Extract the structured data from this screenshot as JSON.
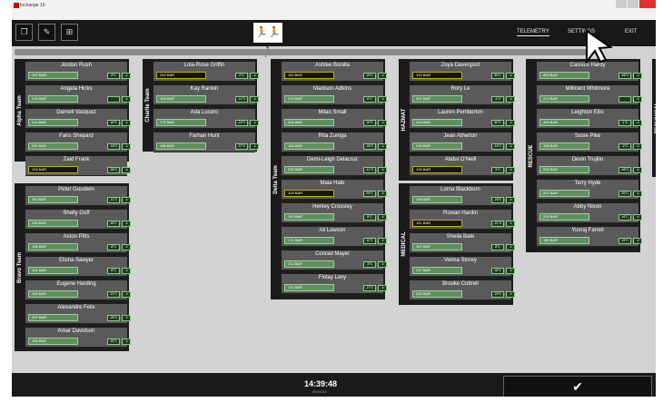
{
  "app": {
    "title": "Inchange 10"
  },
  "toolbar": [
    {
      "icon": "window-icon",
      "glyph": "❐"
    },
    {
      "icon": "edit-icon",
      "glyph": "✎"
    },
    {
      "icon": "grid-icon",
      "glyph": "⊞"
    }
  ],
  "logo": {
    "icon": "running-people-icon",
    "glyph": "🏃🏃🏃"
  },
  "nav": {
    "telemetry": "TELEMETRY",
    "settings": "SETTINGS",
    "exit": "EXIT"
  },
  "teams": [
    {
      "name": "Alpha Team",
      "members": [
        {
          "name": "Jordon Rush",
          "pressure": "197 BAR",
          "temp": "3°C",
          "alert": false
        },
        {
          "name": "Angela Hicks",
          "pressure": "216 BAR",
          "temp": "",
          "alert": false
        },
        {
          "name": "Darnell Vasquez",
          "pressure": "210 BAR",
          "temp": "15°C",
          "alert": false
        },
        {
          "name": "Faris Shepard",
          "pressure": "200 BAR",
          "temp": "-18°C",
          "alert": false
        },
        {
          "name": "Zaid Frank",
          "pressure": "133 BAR",
          "temp": "-38°C",
          "alert": true
        }
      ]
    },
    {
      "name": "Bravo Team",
      "members": [
        {
          "name": "Peter Goodwin",
          "pressure": "262 BAR",
          "temp": "-11°C",
          "alert": false
        },
        {
          "name": "Shelly Goff",
          "pressure": "246 BAR",
          "temp": "18°C",
          "alert": false
        },
        {
          "name": "Aston Pitts",
          "pressure": "186 BAR",
          "temp": "8°C",
          "alert": false
        },
        {
          "name": "Elisha Sawyer",
          "pressure": "161 BAR",
          "temp": "8°C",
          "alert": false
        },
        {
          "name": "Eugene Harding",
          "pressure": "195 BAR",
          "temp": "12°C",
          "alert": false
        },
        {
          "name": "Alexandre Felix",
          "pressure": "207 BAR",
          "temp": "-26°C",
          "alert": false
        },
        {
          "name": "Amar Davidson",
          "pressure": "188 BAR",
          "temp": "16°C",
          "alert": false
        }
      ]
    },
    {
      "name": "Charlie Team",
      "members": [
        {
          "name": "Lola-Rose Griffin",
          "pressure": "244 BAR",
          "temp": "2°C",
          "alert": true
        },
        {
          "name": "Kay Rankin",
          "pressure": "158 BAR",
          "temp": "-12°C",
          "alert": false
        },
        {
          "name": "Ada Lucero",
          "pressure": "175 BAR",
          "temp": "-24°C",
          "alert": false
        },
        {
          "name": "Farhan Hunt",
          "pressure": "186 BAR",
          "temp": "-27°C",
          "alert": false
        }
      ]
    },
    {
      "name": "Delta Team",
      "members": [
        {
          "name": "Ashlee Bonilla",
          "pressure": "110 BAR",
          "temp": "19°C",
          "alert": true
        },
        {
          "name": "Madison Adkins",
          "pressure": "212 BAR",
          "temp": "6°C",
          "alert": false
        },
        {
          "name": "Milan Small",
          "pressure": "202 BAR",
          "temp": "19°C",
          "alert": false
        },
        {
          "name": "Rita Zuniga",
          "pressure": "188 BAR",
          "temp": "-25°C",
          "alert": false
        },
        {
          "name": "Demi-Leigh Delacruz",
          "pressure": "222 BAR",
          "temp": "-11°C",
          "alert": false
        },
        {
          "name": "Maia Hale",
          "pressure": "129 BAR",
          "temp": "29°C",
          "alert": true
        },
        {
          "name": "Henley Crossley",
          "pressure": "190 BAR",
          "temp": "6°C",
          "alert": false
        },
        {
          "name": "Ali Lawson",
          "pressure": "171 BAR",
          "temp": "11°C",
          "alert": false
        },
        {
          "name": "Conrad Mayer",
          "pressure": "211 BAR",
          "temp": "-5°C",
          "alert": false
        },
        {
          "name": "Finlay Levy",
          "pressure": "170 BAR",
          "temp": "-27°C",
          "alert": false
        }
      ]
    },
    {
      "name": "HAZMAT",
      "members": [
        {
          "name": "Zoya Davenport",
          "pressure": "133 BAR",
          "temp": "30°C",
          "alert": true
        },
        {
          "name": "Rory Le",
          "pressure": "207 BAR",
          "temp": "-1°C",
          "alert": false
        },
        {
          "name": "Lauren Pemberton",
          "pressure": "224 BAR",
          "temp": "30°C",
          "alert": false
        },
        {
          "name": "Jean Atherton",
          "pressure": "239 BAR",
          "temp": "-16°C",
          "alert": false
        },
        {
          "name": "Abdul O'Neill",
          "pressure": "126 BAR",
          "temp": "1°C",
          "alert": true
        }
      ]
    },
    {
      "name": "MEDICAL",
      "members": [
        {
          "name": "Lorna Blackburn",
          "pressure": "198 BAR",
          "temp": "-26°C",
          "alert": false
        },
        {
          "name": "Rowan Hardin",
          "pressure": "141 BAR",
          "temp": "-21°C",
          "alert": true
        },
        {
          "name": "Sheila Bate",
          "pressure": "167 BAR",
          "temp": "8°C",
          "alert": false
        },
        {
          "name": "Velma Storey",
          "pressure": "247 BAR",
          "temp": "16°C",
          "alert": false
        },
        {
          "name": "Brooke Cottrell",
          "pressure": "220 BAR",
          "temp": "-29°C",
          "alert": false
        }
      ]
    },
    {
      "name": "RESCUE",
      "members": [
        {
          "name": "Cassius Hardy",
          "pressure": "203 BAR",
          "temp": "-26°C",
          "alert": false
        },
        {
          "name": "Millicent Whitmore",
          "pressure": "214 BAR",
          "temp": "",
          "alert": false
        },
        {
          "name": "Leighton Ellis",
          "pressure": "192 BAR",
          "temp": "-1°C",
          "alert": false
        },
        {
          "name": "Susie Pike",
          "pressure": "166 BAR",
          "temp": "-2°C",
          "alert": false
        },
        {
          "name": "Devin Trujillo",
          "pressure": "230 BAR",
          "temp": "-36°C",
          "alert": false
        },
        {
          "name": "Terry Hyde",
          "pressure": "207 BAR",
          "temp": "29°C",
          "alert": false
        },
        {
          "name": "Abby Nixon",
          "pressure": "229 BAR",
          "temp": "14°C",
          "alert": false
        },
        {
          "name": "Yuvraj Farrell",
          "pressure": "180 BAR",
          "temp": "13°C",
          "alert": false
        }
      ]
    },
    {
      "name": "TECHNICAL",
      "members": []
    }
  ],
  "signal": {
    "icon": "signal-icon",
    "glyph": ".ıl"
  },
  "footer": {
    "clock": "14:39:48",
    "elapsed": "00:00:22",
    "confirm_icon": "checkmark-icon",
    "confirm_glyph": "✔"
  }
}
